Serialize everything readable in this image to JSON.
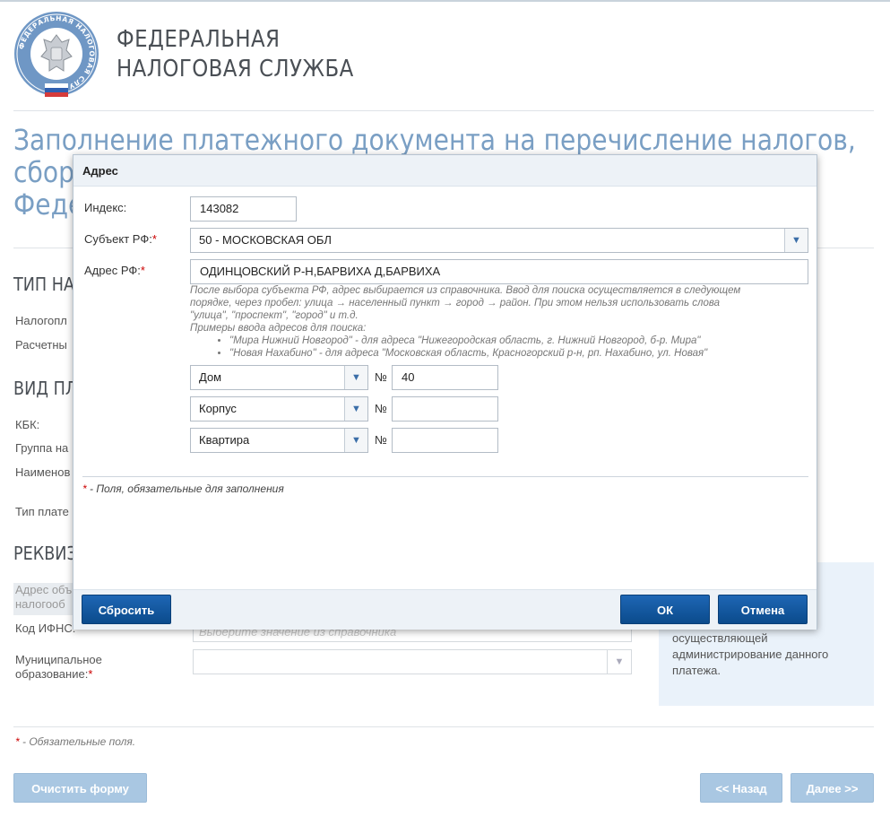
{
  "header": {
    "org_line1": "ФЕДЕРАЛЬНАЯ",
    "org_line2": "НАЛОГОВАЯ СЛУЖБА",
    "logo_ring_text": "ФЕДЕРАЛЬНАЯ НАЛОГОВАЯ СЛУЖБА"
  },
  "page": {
    "title_line1": "Заполнение платежного документа на перечисление налогов,",
    "title_line2": "сбор",
    "title_line3": "Феде"
  },
  "background": {
    "section_type": "ТИП НАЛ",
    "label_payer": "Налогопл",
    "label_settlement": "Расчетны",
    "section_kind": "ВИД ПЛА",
    "label_kbk": "КБК:",
    "label_group": "Группа на",
    "label_name": "Наименов",
    "label_payment_type": "Тип плате",
    "section_requisites": "РЕКВИЗ",
    "label_addr_obj_1": "Адрес объ",
    "label_addr_obj_2": "налогооб",
    "label_ifns": "Код ИФНС:",
    "ifns_placeholder": "Выберите значение из справочника",
    "label_municipal_1": "Муниципальное",
    "label_municipal_2": "образование:",
    "required_mark": "*",
    "info_text": "осуществляющей администрирование данного платежа.",
    "footnote_star": "*",
    "footnote_text": " - Обязательные поля.",
    "btn_clear": "Очистить форму",
    "btn_back": "<< Назад",
    "btn_next": "Далее >>"
  },
  "modal": {
    "title": "Адрес",
    "index_label": "Индекс:",
    "index_value": "143082",
    "subject_label": "Субъект РФ:",
    "subject_value": "50 - МОСКОВСКАЯ ОБЛ",
    "address_label": "Адрес РФ:",
    "address_value": "ОДИНЦОВСКИЙ Р-Н,БАРВИХА Д,БАРВИХА",
    "required_mark": "*",
    "hint_line1": "После выбора субъекта РФ, адрес выбирается из справочника. Ввод для поиска осуществляется в следующем",
    "hint_line2": "порядке, через пробел: улица → населенный пункт → город → район. При этом нельзя использовать слова",
    "hint_line3": "\"улица\", \"проспект\", \"город\" и т.д.",
    "hint_line4": "Примеры ввода адресов для поиска:",
    "hint_example1": "\"Мира Нижний Новгород\" - для адреса \"Нижегородская область, г. Нижний Новгород, б-р. Мира\"",
    "hint_example2": "\"Новая Нахабино\" - для адреса \"Московская область, Красногорский р-н, рп. Нахабино, ул. Новая\"",
    "house_type": "Дом",
    "house_num_label": "№",
    "house_value": "40",
    "building_type": "Корпус",
    "building_num_label": "№",
    "building_value": "",
    "apartment_type": "Квартира",
    "apartment_num_label": "№",
    "apartment_value": "",
    "note_star": "*",
    "note_text": " - Поля, обязательные для заполнения",
    "btn_reset": "Сбросить",
    "btn_ok": "ОК",
    "btn_cancel": "Отмена"
  },
  "colors": {
    "accent": "#0b4b8c",
    "title_blue": "#7a9fc4",
    "required": "#cc0000"
  }
}
